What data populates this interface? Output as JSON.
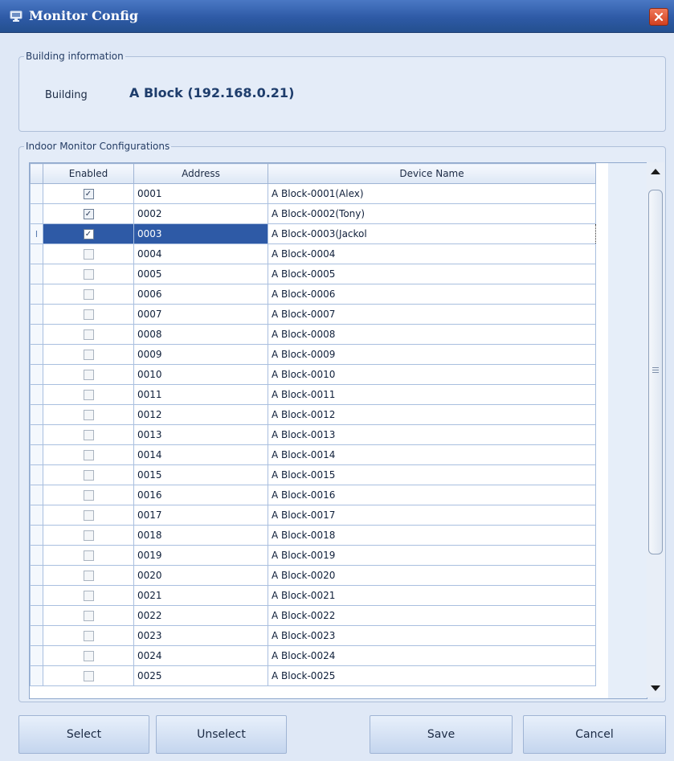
{
  "window": {
    "title": "Monitor Config"
  },
  "building_group": {
    "legend": "Building information",
    "label": "Building",
    "value": "A Block (192.168.0.21)"
  },
  "monitor_group": {
    "legend": "Indoor Monitor Configurations"
  },
  "table": {
    "columns": [
      "Enabled",
      "Address",
      "Device Name"
    ],
    "selected_row_index": 2,
    "rows": [
      {
        "enabled": true,
        "address": "0001",
        "name": "A Block-0001(Alex)"
      },
      {
        "enabled": true,
        "address": "0002",
        "name": "A Block-0002(Tony)"
      },
      {
        "enabled": true,
        "address": "0003",
        "name": "A Block-0003(Jackol"
      },
      {
        "enabled": false,
        "address": "0004",
        "name": "A Block-0004"
      },
      {
        "enabled": false,
        "address": "0005",
        "name": "A Block-0005"
      },
      {
        "enabled": false,
        "address": "0006",
        "name": "A Block-0006"
      },
      {
        "enabled": false,
        "address": "0007",
        "name": "A Block-0007"
      },
      {
        "enabled": false,
        "address": "0008",
        "name": "A Block-0008"
      },
      {
        "enabled": false,
        "address": "0009",
        "name": "A Block-0009"
      },
      {
        "enabled": false,
        "address": "0010",
        "name": "A Block-0010"
      },
      {
        "enabled": false,
        "address": "0011",
        "name": "A Block-0011"
      },
      {
        "enabled": false,
        "address": "0012",
        "name": "A Block-0012"
      },
      {
        "enabled": false,
        "address": "0013",
        "name": "A Block-0013"
      },
      {
        "enabled": false,
        "address": "0014",
        "name": "A Block-0014"
      },
      {
        "enabled": false,
        "address": "0015",
        "name": "A Block-0015"
      },
      {
        "enabled": false,
        "address": "0016",
        "name": "A Block-0016"
      },
      {
        "enabled": false,
        "address": "0017",
        "name": "A Block-0017"
      },
      {
        "enabled": false,
        "address": "0018",
        "name": "A Block-0018"
      },
      {
        "enabled": false,
        "address": "0019",
        "name": "A Block-0019"
      },
      {
        "enabled": false,
        "address": "0020",
        "name": "A Block-0020"
      },
      {
        "enabled": false,
        "address": "0021",
        "name": "A Block-0021"
      },
      {
        "enabled": false,
        "address": "0022",
        "name": "A Block-0022"
      },
      {
        "enabled": false,
        "address": "0023",
        "name": "A Block-0023"
      },
      {
        "enabled": false,
        "address": "0024",
        "name": "A Block-0024"
      },
      {
        "enabled": false,
        "address": "0025",
        "name": "A Block-0025"
      }
    ]
  },
  "buttons": {
    "select": "Select",
    "unselect": "Unselect",
    "save": "Save",
    "cancel": "Cancel"
  },
  "icons": {
    "app": "monitor-icon",
    "close": "close-icon",
    "checkbox_checked": "✓",
    "row_indicator": "I"
  },
  "colors": {
    "titlebar": "#2e5aa6",
    "selection": "#2e5aa6",
    "close_button": "#d2401f",
    "background": "#dfe8f6"
  }
}
